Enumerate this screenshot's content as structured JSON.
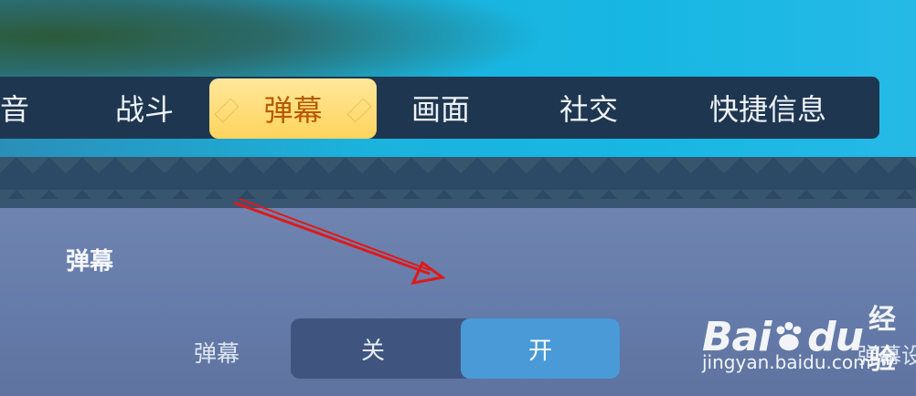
{
  "tabs": [
    {
      "label": "音",
      "active": false
    },
    {
      "label": "战斗",
      "active": false
    },
    {
      "label": "弹幕",
      "active": true
    },
    {
      "label": "画面",
      "active": false
    },
    {
      "label": "社交",
      "active": false
    },
    {
      "label": "快捷信息",
      "active": false
    }
  ],
  "section": {
    "title": "弹幕"
  },
  "setting": {
    "label": "弹幕",
    "options": [
      "关",
      "开"
    ],
    "selected": "开"
  },
  "next_label_partial": "弹幕设",
  "watermark": {
    "brand_a": "Bai",
    "brand_b": "du",
    "suffix": "经验",
    "url": "jingyan.baidu.com"
  },
  "colors": {
    "accent_tab": "#ffd45e",
    "toggle_on": "#4a9ad8",
    "arrow": "#e01818"
  }
}
